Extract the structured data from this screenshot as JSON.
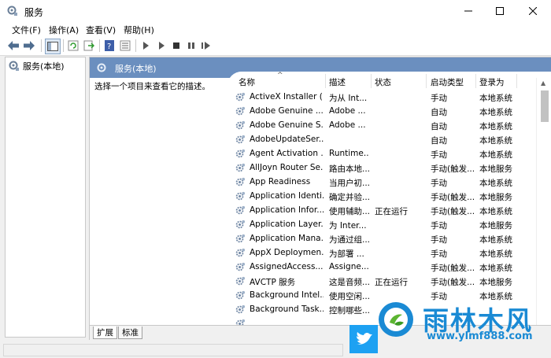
{
  "window": {
    "title": "服务"
  },
  "menu": [
    "文件(F)",
    "操作(A)",
    "查看(V)",
    "帮助(H)"
  ],
  "tree": {
    "item": "服务(本地)"
  },
  "panel": {
    "header": "服务(本地)",
    "description": "选择一个项目来查看它的描述。"
  },
  "columns": {
    "name": "名称",
    "description": "描述",
    "status": "状态",
    "startup": "启动类型",
    "logon": "登录为"
  },
  "services": [
    {
      "name": "ActiveX Installer (...",
      "description": "为从 Int...",
      "status": "",
      "startup": "手动",
      "logon": "本地系统"
    },
    {
      "name": "Adobe Genuine ...",
      "description": "Adobe ...",
      "status": "",
      "startup": "自动",
      "logon": "本地系统"
    },
    {
      "name": "Adobe Genuine S...",
      "description": "Adobe ...",
      "status": "",
      "startup": "自动",
      "logon": "本地系统"
    },
    {
      "name": "AdobeUpdateSer...",
      "description": "",
      "status": "",
      "startup": "自动",
      "logon": "本地系统"
    },
    {
      "name": "Agent Activation ...",
      "description": "Runtime...",
      "status": "",
      "startup": "手动",
      "logon": "本地系统"
    },
    {
      "name": "AllJoyn Router Se...",
      "description": "路由本地...",
      "status": "",
      "startup": "手动(触发...",
      "logon": "本地服务"
    },
    {
      "name": "App Readiness",
      "description": "当用户初...",
      "status": "",
      "startup": "手动",
      "logon": "本地系统"
    },
    {
      "name": "Application Identi...",
      "description": "确定并验...",
      "status": "",
      "startup": "手动(触发...",
      "logon": "本地服务"
    },
    {
      "name": "Application Infor...",
      "description": "使用辅助...",
      "status": "正在运行",
      "startup": "手动(触发...",
      "logon": "本地系统"
    },
    {
      "name": "Application Layer...",
      "description": "为 Inter...",
      "status": "",
      "startup": "手动",
      "logon": "本地服务"
    },
    {
      "name": "Application Mana...",
      "description": "为通过组...",
      "status": "",
      "startup": "手动",
      "logon": "本地系统"
    },
    {
      "name": "AppX Deploymen...",
      "description": "为部署 ...",
      "status": "",
      "startup": "手动",
      "logon": "本地系统"
    },
    {
      "name": "AssignedAccess...",
      "description": "Assigne...",
      "status": "",
      "startup": "手动(触发...",
      "logon": "本地系统"
    },
    {
      "name": "AVCTP 服务",
      "description": "这是音频...",
      "status": "正在运行",
      "startup": "手动(触发...",
      "logon": "本地服务"
    },
    {
      "name": "Background Intel...",
      "description": "使用空闲...",
      "status": "",
      "startup": "手动",
      "logon": "本地系统"
    },
    {
      "name": "Background Task...",
      "description": "控制哪些...",
      "status": "",
      "startup": "",
      "logon": ""
    },
    {
      "name": "",
      "description": "",
      "status": "",
      "startup": "",
      "logon": ""
    }
  ],
  "tabs": [
    "扩展",
    "标准"
  ],
  "watermark": {
    "title": "雨林木风",
    "url": "www.ylmf888.com"
  },
  "colors": {
    "header": "#6b8fbf",
    "accent": "#1a8ad4"
  }
}
